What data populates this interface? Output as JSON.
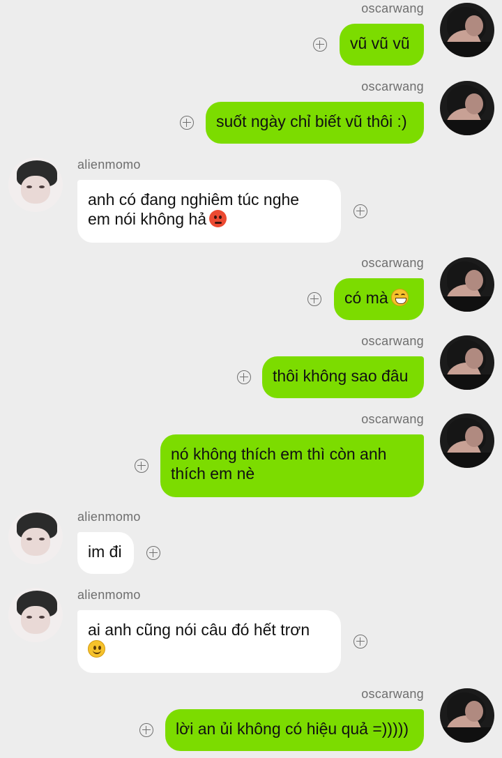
{
  "messages": [
    {
      "side": "right",
      "sender": "oscarwang",
      "lines": [
        {
          "text": "vũ vũ vũ"
        }
      ]
    },
    {
      "side": "right",
      "sender": "oscarwang",
      "lines": [
        {
          "text": "suốt ngày chỉ biết vũ thôi :)"
        }
      ]
    },
    {
      "side": "left",
      "sender": "alienmomo",
      "lines": [
        {
          "text": "anh có đang nghiêm túc nghe"
        },
        {
          "text": "em nói không hả",
          "emoji": "angry-face-icon"
        }
      ]
    },
    {
      "side": "right",
      "sender": "oscarwang",
      "lines": [
        {
          "text": "có mà",
          "emoji": "grinning-face-icon"
        }
      ]
    },
    {
      "side": "right",
      "sender": "oscarwang",
      "lines": [
        {
          "text": "thôi không sao đâu"
        }
      ]
    },
    {
      "side": "right",
      "sender": "oscarwang",
      "lines": [
        {
          "text": "nó không thích em thì còn anh"
        },
        {
          "text": "thích em nè"
        }
      ]
    },
    {
      "side": "left",
      "sender": "alienmomo",
      "lines": [
        {
          "text": "im đi"
        }
      ]
    },
    {
      "side": "left",
      "sender": "alienmomo",
      "lines": [
        {
          "text": "ai anh cũng nói câu đó hết trơn"
        },
        {
          "text": "",
          "emoji": "smiling-face-icon"
        }
      ]
    },
    {
      "side": "right",
      "sender": "oscarwang",
      "lines": [
        {
          "text": "lời an ủi không có hiệu quả =)))))"
        }
      ]
    }
  ],
  "colors": {
    "background": "#ededed",
    "outgoing_bubble": "#7cdc00",
    "incoming_bubble": "#ffffff",
    "sender_name": "#6e6e6e"
  }
}
